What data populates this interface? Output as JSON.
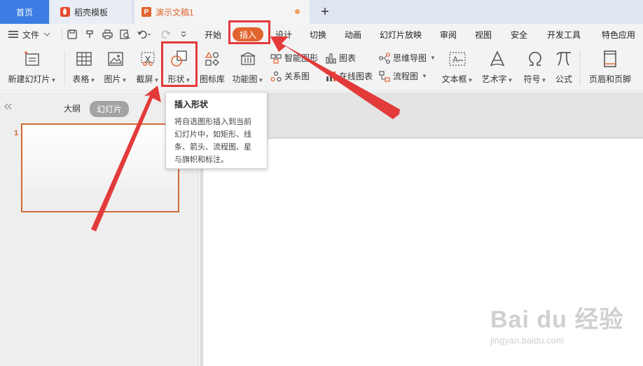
{
  "tabs": {
    "home": "首页",
    "template": "稻壳模板",
    "document": "演示文稿1",
    "add": "+"
  },
  "menu": {
    "file": "文件",
    "items": [
      "开始",
      "插入",
      "设计",
      "切换",
      "动画",
      "幻灯片放映",
      "审阅",
      "视图",
      "安全",
      "开发工具",
      "特色应用"
    ]
  },
  "ribbon": {
    "new_slide": "新建幻灯片",
    "table": "表格",
    "picture": "图片",
    "screenshot": "截屏",
    "shape": "形状",
    "icon_library": "图标库",
    "function_chart": "功能图",
    "smart_graphic": "智能图形",
    "relation_chart": "关系图",
    "chart": "图表",
    "online_chart": "在线图表",
    "mind_map": "思维导图",
    "flowchart": "流程图",
    "textbox": "文本框",
    "wordart": "艺术字",
    "symbol": "符号",
    "formula": "公式",
    "header_footer": "页眉和页脚"
  },
  "left_panel": {
    "outline": "大纲",
    "slides": "幻灯片",
    "slide_number": "1"
  },
  "tooltip": {
    "title": "插入形状",
    "body": "将自选图形插入到当前幻灯片中，如矩形、线条、箭头、流程图、星与旗帜和标注。"
  },
  "watermark": {
    "brand": "Bai du 经验",
    "url": "jingyan.baidu.com"
  },
  "colors": {
    "accent_orange": "#e2632d",
    "tab_blue": "#3b7de3",
    "highlight_red": "#e33a3a"
  }
}
